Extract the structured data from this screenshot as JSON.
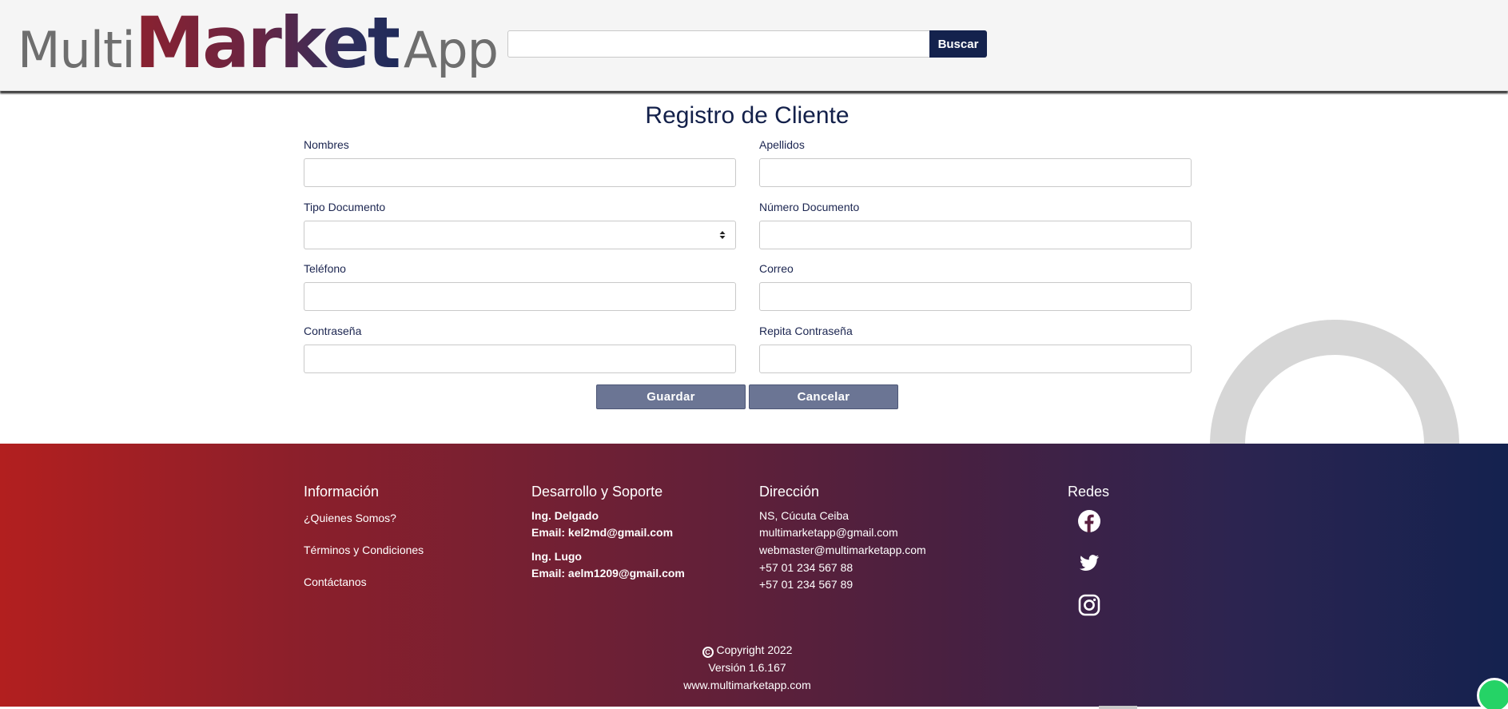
{
  "header": {
    "logo": {
      "part1": "Multi",
      "part2": "Market",
      "part3": "App"
    },
    "search": {
      "value": "",
      "placeholder": ""
    },
    "search_button": "Buscar"
  },
  "form": {
    "title": "Registro de Cliente",
    "fields": {
      "nombres": {
        "label": "Nombres",
        "value": ""
      },
      "apellidos": {
        "label": "Apellidos",
        "value": ""
      },
      "tipo_documento": {
        "label": "Tipo Documento",
        "value": ""
      },
      "numero_documento": {
        "label": "Número Documento",
        "value": ""
      },
      "telefono": {
        "label": "Teléfono",
        "value": ""
      },
      "correo": {
        "label": "Correo",
        "value": ""
      },
      "contrasena": {
        "label": "Contraseña",
        "value": ""
      },
      "repita_contrasena": {
        "label": "Repita Contraseña",
        "value": ""
      }
    },
    "save_label": "Guardar",
    "cancel_label": "Cancelar"
  },
  "footer": {
    "info": {
      "heading": "Información",
      "links": [
        "¿Quienes Somos?",
        "Términos y Condiciones",
        "Contáctanos"
      ]
    },
    "support": {
      "heading": "Desarrollo y Soporte",
      "people": [
        {
          "name": "Ing. Delgado",
          "email": "Email: kel2md@gmail.com"
        },
        {
          "name": "Ing. Lugo",
          "email": "Email: aelm1209@gmail.com"
        }
      ]
    },
    "address": {
      "heading": "Dirección",
      "lines": [
        "NS, Cúcuta Ceiba",
        "multimarketapp@gmail.com",
        "webmaster@multimarketapp.com",
        "+57 01 234 567 88",
        "+57 01 234 567 89"
      ]
    },
    "social": {
      "heading": "Redes",
      "icons": [
        "facebook-icon",
        "twitter-icon",
        "instagram-icon"
      ]
    },
    "copyright": "Copyright 2022",
    "version": "Versión 1.6.167",
    "website": "www.multimarketapp.com"
  },
  "colors": {
    "brand_navy": "#14224d",
    "button_gray": "#6b7594",
    "footer_start": "#b21f1f",
    "footer_end": "#14224f"
  }
}
